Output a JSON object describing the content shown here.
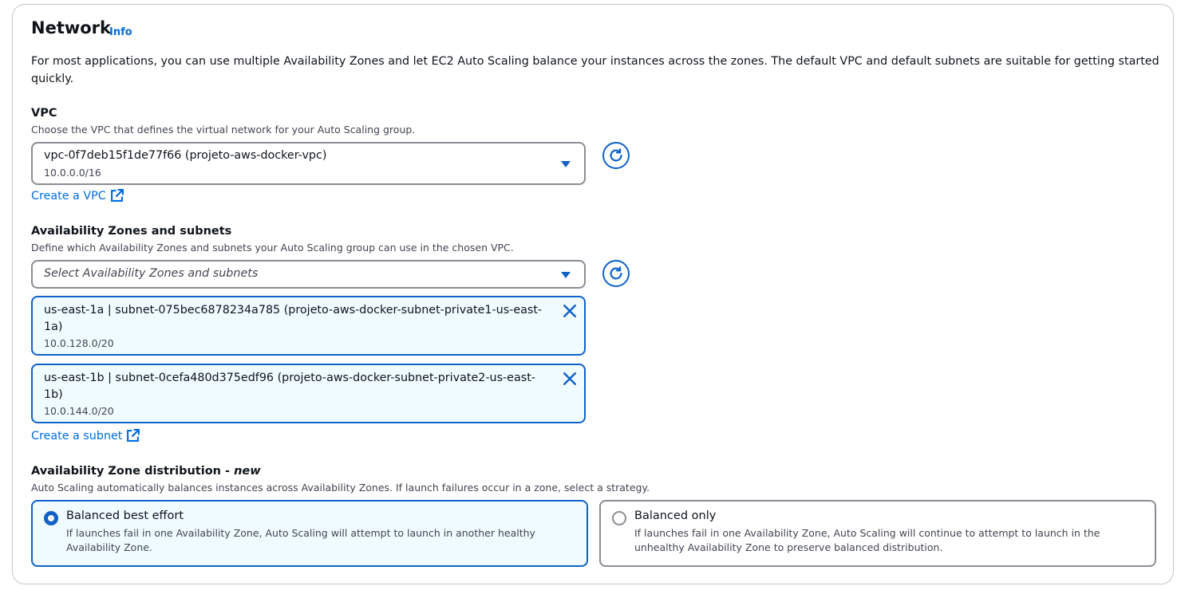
{
  "network": {
    "title": "Network",
    "info_link": "Info",
    "description": "For most applications, you can use multiple Availability Zones and let EC2 Auto Scaling balance your instances across the zones. The default VPC and default subnets are suitable for getting started quickly."
  },
  "vpc": {
    "label": "VPC",
    "description": "Choose the VPC that defines the virtual network for your Auto Scaling group.",
    "selected_value": "vpc-0f7deb15f1de77f66 (projeto-aws-docker-vpc)",
    "selected_cidr": "10.0.0.0/16",
    "create_link": "Create a VPC"
  },
  "az_subnets": {
    "label": "Availability Zones and subnets",
    "description": "Define which Availability Zones and subnets your Auto Scaling group can use in the chosen VPC.",
    "placeholder": "Select Availability Zones and subnets",
    "tokens": [
      {
        "label": "us-east-1a | subnet-075bec6878234a785 (projeto-aws-docker-subnet-private1-us-east-1a)",
        "cidr": "10.0.128.0/20"
      },
      {
        "label": "us-east-1b | subnet-0cefa480d375edf96 (projeto-aws-docker-subnet-private2-us-east-1b)",
        "cidr": "10.0.144.0/20"
      }
    ],
    "create_link": "Create a subnet"
  },
  "az_distribution": {
    "label": "Availability Zone distribution - ",
    "label_new": "new",
    "description": "Auto Scaling automatically balances instances across Availability Zones. If launch failures occur in a zone, select a strategy.",
    "options": [
      {
        "title": "Balanced best effort",
        "description": "If launches fail in one Availability Zone, Auto Scaling will attempt to launch in another healthy Availability Zone.",
        "selected": true
      },
      {
        "title": "Balanced only",
        "description": "If launches fail in one Availability Zone, Auto Scaling will continue to attempt to launch in the unhealthy Availability Zone to preserve balanced distribution.",
        "selected": false
      }
    ]
  },
  "colors": {
    "accent": "#0f62c8",
    "link": "#006ce0",
    "selected_bg": "#f0fbff",
    "border": "#8c8c94"
  }
}
